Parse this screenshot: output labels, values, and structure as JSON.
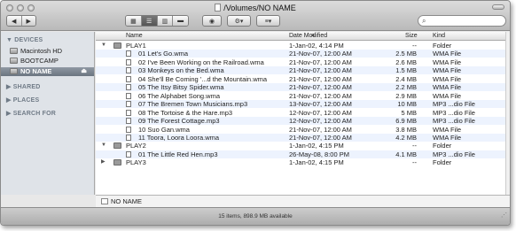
{
  "window": {
    "title": "/Volumes/NO NAME"
  },
  "toolbar": {
    "back_glyph": "◀",
    "forward_glyph": "▶",
    "view_icon": "view-icons-icon",
    "view_list": "view-list-icon",
    "view_columns": "view-columns-icon",
    "view_coverflow": "view-coverflow-icon",
    "eye_glyph": "👁",
    "action_glyph": "⚙▾",
    "arrange_glyph": "≡▾",
    "search_placeholder": ""
  },
  "sidebar": {
    "devices_label": "▼ DEVICES",
    "devices": [
      {
        "label": "Macintosh HD",
        "selected": false
      },
      {
        "label": "BOOTCAMP",
        "selected": false
      },
      {
        "label": "NO NAME",
        "selected": true
      }
    ],
    "sections": [
      {
        "label": "▶ SHARED"
      },
      {
        "label": "▶ PLACES"
      },
      {
        "label": "▶ SEARCH FOR"
      }
    ]
  },
  "columns": {
    "name": "Name",
    "date": "Date Modified",
    "size": "Size",
    "kind": "Kind"
  },
  "rows": [
    {
      "level": 0,
      "type": "folder",
      "expanded": true,
      "name": "PLAY1",
      "date": "1-Jan-02, 4:14 PM",
      "size": "--",
      "kind": "Folder"
    },
    {
      "level": 1,
      "type": "file",
      "name": "01 Let's Go.wma",
      "date": "21-Nov-07, 12:00 AM",
      "size": "2.5 MB",
      "kind": "WMA File"
    },
    {
      "level": 1,
      "type": "file",
      "name": "02 I've Been Working on the Railroad.wma",
      "date": "21-Nov-07, 12:00 AM",
      "size": "2.6 MB",
      "kind": "WMA File"
    },
    {
      "level": 1,
      "type": "file",
      "name": "03 Monkeys on the Bed.wma",
      "date": "21-Nov-07, 12:00 AM",
      "size": "1.5 MB",
      "kind": "WMA File"
    },
    {
      "level": 1,
      "type": "file",
      "name": "04 She'll Be Coming '...d the Mountain.wma",
      "date": "21-Nov-07, 12:00 AM",
      "size": "2.4 MB",
      "kind": "WMA File"
    },
    {
      "level": 1,
      "type": "file",
      "name": "05 The Itsy Bitsy Spider.wma",
      "date": "21-Nov-07, 12:00 AM",
      "size": "2.2 MB",
      "kind": "WMA File"
    },
    {
      "level": 1,
      "type": "file",
      "name": "06 The Alphabet Song.wma",
      "date": "21-Nov-07, 12:00 AM",
      "size": "2.9 MB",
      "kind": "WMA File"
    },
    {
      "level": 1,
      "type": "file",
      "name": "07 The Bremen Town Musicians.mp3",
      "date": "13-Nov-07, 12:00 AM",
      "size": "10 MB",
      "kind": "MP3 ...dio File"
    },
    {
      "level": 1,
      "type": "file",
      "name": "08 The Tortoise & the Hare.mp3",
      "date": "12-Nov-07, 12:00 AM",
      "size": "5 MB",
      "kind": "MP3 ...dio File"
    },
    {
      "level": 1,
      "type": "file",
      "name": "09 The Forest Cottage.mp3",
      "date": "12-Nov-07, 12:00 AM",
      "size": "6.9 MB",
      "kind": "MP3 ...dio File"
    },
    {
      "level": 1,
      "type": "file",
      "name": "10 Suo Gan.wma",
      "date": "21-Nov-07, 12:00 AM",
      "size": "3.8 MB",
      "kind": "WMA File"
    },
    {
      "level": 1,
      "type": "file",
      "name": "11 Toora, Loora Loora.wma",
      "date": "21-Nov-07, 12:00 AM",
      "size": "4.2 MB",
      "kind": "WMA File"
    },
    {
      "level": 0,
      "type": "folder",
      "expanded": true,
      "name": "PLAY2",
      "date": "1-Jan-02, 4:15 PM",
      "size": "--",
      "kind": "Folder"
    },
    {
      "level": 1,
      "type": "file",
      "name": "01 The Little Red Hen.mp3",
      "date": "26-May-08, 8:00 PM",
      "size": "4.1 MB",
      "kind": "MP3 ...dio File"
    },
    {
      "level": 0,
      "type": "folder",
      "expanded": false,
      "name": "PLAY3",
      "date": "1-Jan-02, 4:15 PM",
      "size": "--",
      "kind": "Folder"
    }
  ],
  "pathbar": {
    "label": "NO NAME"
  },
  "status": {
    "text": "15 items, 898.9 MB available"
  }
}
